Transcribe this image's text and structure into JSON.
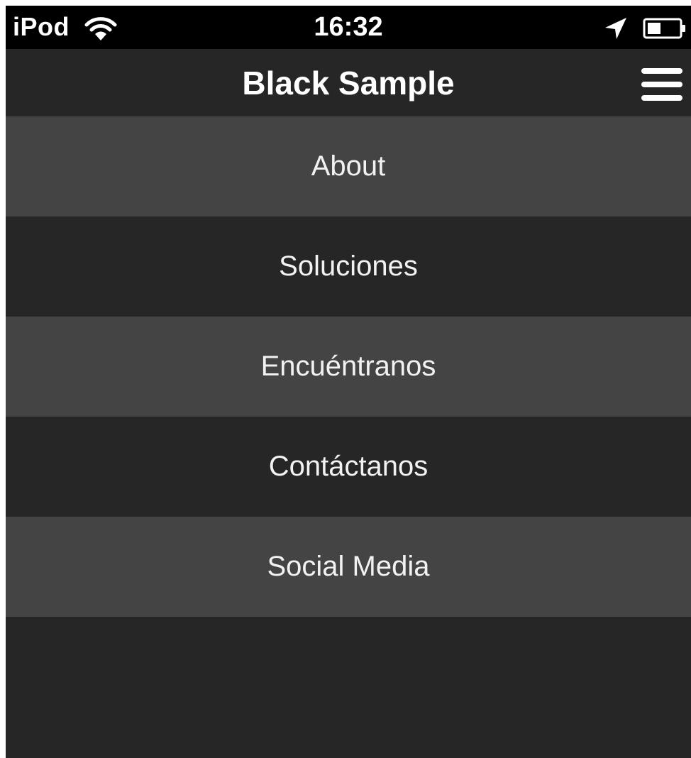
{
  "status_bar": {
    "carrier": "iPod",
    "time": "16:32",
    "icons": [
      "wifi-icon",
      "location-arrow-icon",
      "battery-icon"
    ]
  },
  "nav_bar": {
    "title": "Black Sample",
    "menu_icon": "hamburger-menu-icon"
  },
  "menu": {
    "items": [
      {
        "label": "About"
      },
      {
        "label": "Soluciones"
      },
      {
        "label": "Encuéntranos"
      },
      {
        "label": "Contáctanos"
      },
      {
        "label": "Social Media"
      }
    ]
  },
  "colors": {
    "status_bar_bg": "#000000",
    "nav_bar_bg": "#262626",
    "menu_item_light": "#444444",
    "menu_item_dark": "#262626",
    "text": "#ffffff"
  }
}
